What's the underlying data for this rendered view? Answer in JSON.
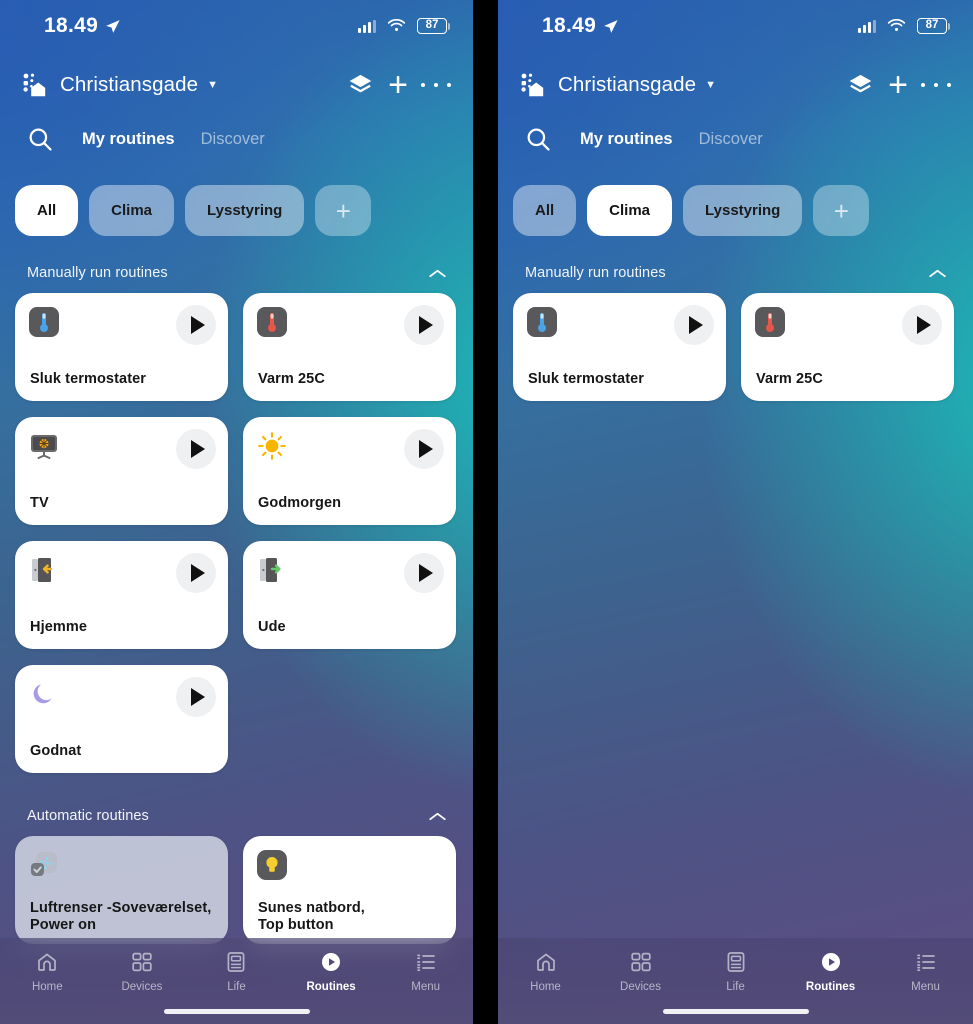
{
  "status_bar": {
    "time": "18.49",
    "location_icon": "navigation-arrow-icon",
    "signal_icon": "cellular-signal-icon",
    "wifi_icon": "wifi-icon",
    "battery_percent": "87"
  },
  "app_bar": {
    "home_logo_icon": "smart-home-logo-icon",
    "home_name": "Christiansgade",
    "caret_icon": "chevron-down-icon",
    "layers_icon": "layers-icon",
    "add_icon": "plus-icon",
    "more_icon": "kebab-menu-icon"
  },
  "tabs": {
    "search_icon": "search-icon",
    "items": [
      {
        "label": "My routines",
        "active": true
      },
      {
        "label": "Discover",
        "active": false
      }
    ]
  },
  "filters": {
    "left": [
      {
        "label": "All",
        "selected": true
      },
      {
        "label": "Clima",
        "selected": false
      },
      {
        "label": "Lysstyring",
        "selected": false
      }
    ],
    "right": [
      {
        "label": "All",
        "selected": false
      },
      {
        "label": "Clima",
        "selected": true
      },
      {
        "label": "Lysstyring",
        "selected": false
      }
    ],
    "add_label": "+",
    "add_icon": "plus-icon"
  },
  "sections": {
    "manual": {
      "title": "Manually run routines",
      "collapse_icon": "chevron-up-icon"
    },
    "automatic": {
      "title": "Automatic routines",
      "collapse_icon": "chevron-up-icon"
    }
  },
  "routines_manual_left": [
    {
      "label": "Sluk termostater",
      "icon": "thermometer-cold-icon",
      "play_icon": "play-icon"
    },
    {
      "label": "Varm 25C",
      "icon": "thermometer-hot-icon",
      "play_icon": "play-icon"
    },
    {
      "label": "TV",
      "icon": "television-icon",
      "play_icon": "play-icon"
    },
    {
      "label": "Godmorgen",
      "icon": "sun-icon",
      "play_icon": "play-icon"
    },
    {
      "label": "Hjemme",
      "icon": "door-arrow-in-icon",
      "play_icon": "play-icon"
    },
    {
      "label": "Ude",
      "icon": "door-arrow-out-icon",
      "play_icon": "play-icon"
    },
    {
      "label": "Godnat",
      "icon": "crescent-moon-icon",
      "play_icon": "play-icon"
    }
  ],
  "routines_auto_left": [
    {
      "label": "Luftrenser -Soveværelset,\nPower on",
      "icon": "air-purifier-fan-icon",
      "dim": true
    },
    {
      "label": "Sunes natbord,\nTop button",
      "icon": "light-bulb-icon",
      "dim": false
    }
  ],
  "routines_manual_right": [
    {
      "label": "Sluk termostater",
      "icon": "thermometer-cold-icon",
      "play_icon": "play-icon"
    },
    {
      "label": "Varm 25C",
      "icon": "thermometer-hot-icon",
      "play_icon": "play-icon"
    }
  ],
  "bottom_nav": [
    {
      "label": "Home",
      "icon": "home-icon",
      "active": false
    },
    {
      "label": "Devices",
      "icon": "devices-grid-icon",
      "active": false
    },
    {
      "label": "Life",
      "icon": "life-document-icon",
      "active": false
    },
    {
      "label": "Routines",
      "icon": "routines-play-icon",
      "active": true
    },
    {
      "label": "Menu",
      "icon": "menu-list-icon",
      "active": false
    }
  ],
  "colors": {
    "accent_white": "#ffffff",
    "card_bg": "#ffffff",
    "card_dim_bg": "#ced1e0",
    "play_bg": "#eef0f2",
    "text_dark": "#161616"
  }
}
